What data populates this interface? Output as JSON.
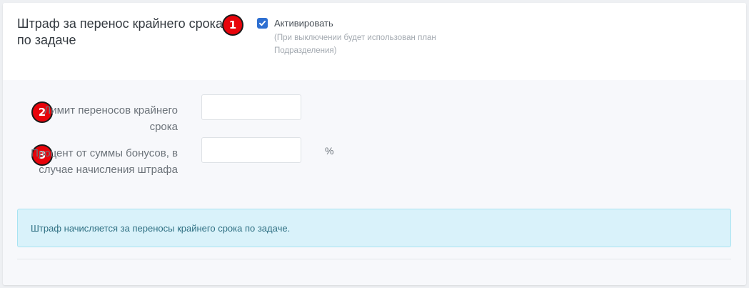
{
  "section": {
    "title": "Штраф за перенос крайнего срока по задаче"
  },
  "activation": {
    "label": "Активировать",
    "checked": true,
    "hint": "(При выключении будет использован план Подразделения)"
  },
  "badges": [
    "1",
    "2",
    "3"
  ],
  "fields": {
    "limit": {
      "label": "Лимит переносов крайнего срока",
      "value": "",
      "placeholder": ""
    },
    "percent": {
      "label": "Процент от суммы бонусов, в случае начисления штрафа",
      "value": "",
      "placeholder": "",
      "unit": "%"
    }
  },
  "alert": {
    "text": "Штраф начисляется за переносы крайнего срока по задаче."
  },
  "colors": {
    "accent": "#2e6fd1",
    "badge": "#e8040b",
    "alert_bg": "#d9f2fa",
    "alert_text": "#2e6f82"
  }
}
